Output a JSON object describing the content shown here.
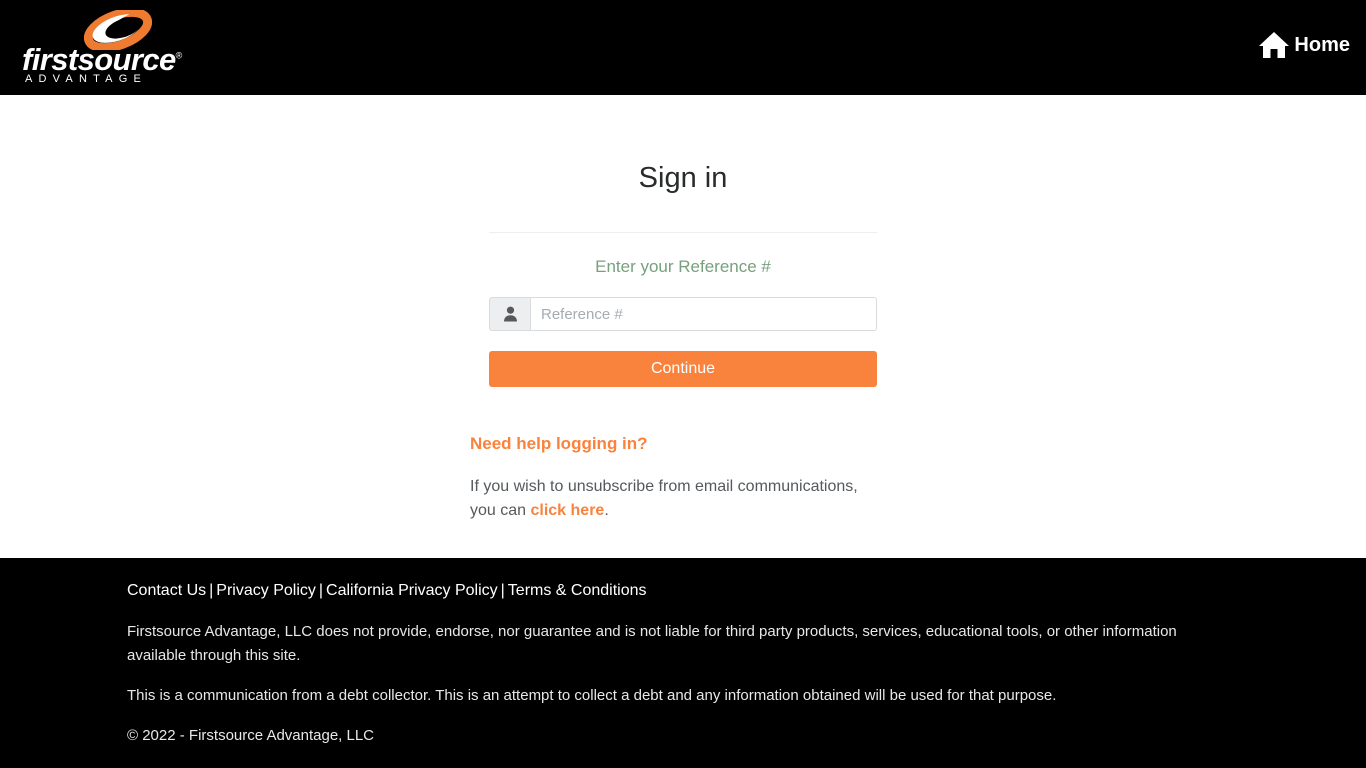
{
  "header": {
    "logo_word": "firstsource",
    "logo_registered": "®",
    "logo_sub": "ADVANTAGE",
    "logo_icon": "swirl-logo-icon",
    "home_icon": "home-icon",
    "home_label": "Home"
  },
  "main": {
    "title": "Sign in",
    "reference_label": "Enter your Reference #",
    "user_icon": "person-icon",
    "reference_placeholder": "Reference #",
    "reference_value": "",
    "continue_label": "Continue",
    "help_title": "Need help logging in?",
    "unsubscribe_text_before": "If you wish to unsubscribe from email communications, you can ",
    "unsubscribe_link": "click here",
    "unsubscribe_text_after": "."
  },
  "footer": {
    "links": [
      {
        "label": "Contact Us"
      },
      {
        "label": "Privacy Policy"
      },
      {
        "label": "California Privacy Policy"
      },
      {
        "label": "Terms & Conditions"
      }
    ],
    "separator": "|",
    "disclaimer": "Firstsource Advantage, LLC does not provide, endorse, nor guarantee and is not liable for third party products, services, educational tools, or other information available through this site.",
    "debt_notice": "This is a communication from a debt collector. This is an attempt to collect a debt and any information obtained will be used for that purpose.",
    "copyright": "© 2022 - Firstsource Advantage, LLC"
  },
  "colors": {
    "accent_orange": "#f9823c",
    "label_green": "#78a07e",
    "header_bg": "#000000",
    "footer_bg": "#000000",
    "body_text": "#55595c"
  }
}
